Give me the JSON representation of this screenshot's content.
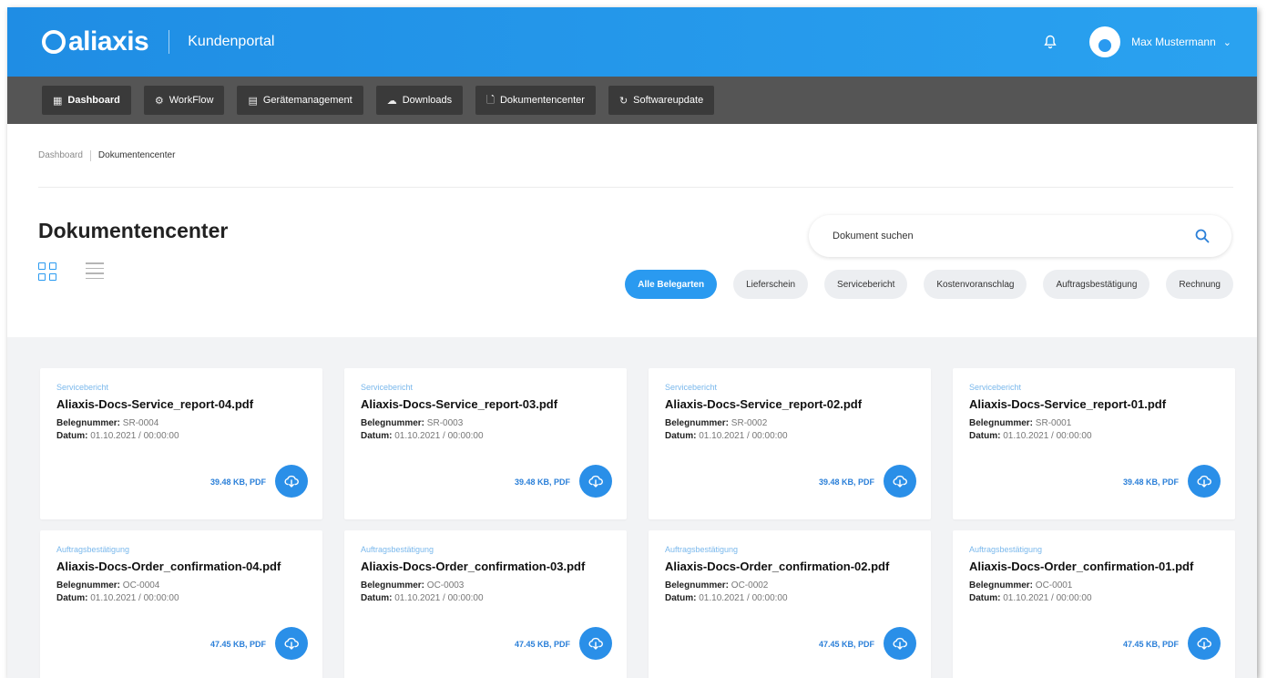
{
  "header": {
    "logo_text": "aliaxis",
    "portal_name": "Kundenportal",
    "user_name": "Max Mustermann"
  },
  "nav": {
    "items": [
      {
        "label": "Dashboard",
        "icon": "grid-icon",
        "active": true
      },
      {
        "label": "WorkFlow",
        "icon": "gear-icon",
        "active": false
      },
      {
        "label": "Gerätemanagement",
        "icon": "device-icon",
        "active": false
      },
      {
        "label": "Downloads",
        "icon": "cloud-download-icon",
        "active": false
      },
      {
        "label": "Dokumentencenter",
        "icon": "document-icon",
        "active": false
      },
      {
        "label": "Softwareupdate",
        "icon": "refresh-icon",
        "active": false
      }
    ]
  },
  "breadcrumb": {
    "root": "Dashboard",
    "current": "Dokumentencenter"
  },
  "page": {
    "title": "Dokumentencenter",
    "search_placeholder": "Dokument suchen"
  },
  "filters": [
    {
      "label": "Alle Belegarten",
      "active": true
    },
    {
      "label": "Lieferschein",
      "active": false
    },
    {
      "label": "Servicebericht",
      "active": false
    },
    {
      "label": "Kostenvoranschlag",
      "active": false
    },
    {
      "label": "Auftragsbestätigung",
      "active": false
    },
    {
      "label": "Rechnung",
      "active": false
    }
  ],
  "labels": {
    "belegnummer": "Belegnummer:",
    "datum": "Datum:"
  },
  "documents": [
    {
      "type": "Servicebericht",
      "title": "Aliaxis-Docs-Service_report-04.pdf",
      "number": "SR-0004",
      "date": "01.10.2021 / 00:00:00",
      "size": "39.48 KB, PDF"
    },
    {
      "type": "Servicebericht",
      "title": "Aliaxis-Docs-Service_report-03.pdf",
      "number": "SR-0003",
      "date": "01.10.2021 / 00:00:00",
      "size": "39.48 KB, PDF"
    },
    {
      "type": "Servicebericht",
      "title": "Aliaxis-Docs-Service_report-02.pdf",
      "number": "SR-0002",
      "date": "01.10.2021 / 00:00:00",
      "size": "39.48 KB, PDF"
    },
    {
      "type": "Servicebericht",
      "title": "Aliaxis-Docs-Service_report-01.pdf",
      "number": "SR-0001",
      "date": "01.10.2021 / 00:00:00",
      "size": "39.48 KB, PDF"
    },
    {
      "type": "Auftragsbestätigung",
      "title": "Aliaxis-Docs-Order_confirmation-04.pdf",
      "number": "OC-0004",
      "date": "01.10.2021 / 00:00:00",
      "size": "47.45 KB, PDF"
    },
    {
      "type": "Auftragsbestätigung",
      "title": "Aliaxis-Docs-Order_confirmation-03.pdf",
      "number": "OC-0003",
      "date": "01.10.2021 / 00:00:00",
      "size": "47.45 KB, PDF"
    },
    {
      "type": "Auftragsbestätigung",
      "title": "Aliaxis-Docs-Order_confirmation-02.pdf",
      "number": "OC-0002",
      "date": "01.10.2021 / 00:00:00",
      "size": "47.45 KB, PDF"
    },
    {
      "type": "Auftragsbestätigung",
      "title": "Aliaxis-Docs-Order_confirmation-01.pdf",
      "number": "OC-0001",
      "date": "01.10.2021 / 00:00:00",
      "size": "47.45 KB, PDF"
    }
  ],
  "colors": {
    "brand_blue": "#2a9af0",
    "nav_bg": "#555555",
    "nav_button": "#3a3a3a",
    "content_bg": "#f2f3f5"
  }
}
